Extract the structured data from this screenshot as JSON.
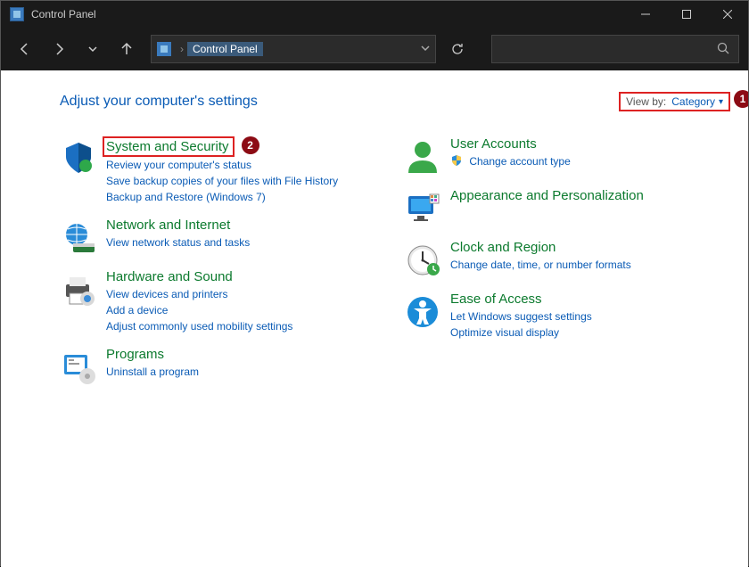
{
  "window": {
    "title": "Control Panel"
  },
  "address": {
    "location": "Control Panel"
  },
  "page": {
    "heading": "Adjust your computer's settings",
    "viewby_label": "View by:",
    "viewby_value": "Category"
  },
  "annotations": {
    "badge1": "1",
    "badge2": "2"
  },
  "categories": {
    "left": [
      {
        "title": "System and Security",
        "links": [
          "Review your computer's status",
          "Save backup copies of your files with File History",
          "Backup and Restore (Windows 7)"
        ],
        "icon": "shield",
        "highlighted": true
      },
      {
        "title": "Network and Internet",
        "links": [
          "View network status and tasks"
        ],
        "icon": "globe"
      },
      {
        "title": "Hardware and Sound",
        "links": [
          "View devices and printers",
          "Add a device",
          "Adjust commonly used mobility settings"
        ],
        "icon": "printer"
      },
      {
        "title": "Programs",
        "links": [
          "Uninstall a program"
        ],
        "icon": "programs"
      }
    ],
    "right": [
      {
        "title": "User Accounts",
        "links": [
          "Change account type"
        ],
        "icon": "user",
        "shield_on_first": true
      },
      {
        "title": "Appearance and Personalization",
        "links": [],
        "icon": "monitor"
      },
      {
        "title": "Clock and Region",
        "links": [
          "Change date, time, or number formats"
        ],
        "icon": "clock"
      },
      {
        "title": "Ease of Access",
        "links": [
          "Let Windows suggest settings",
          "Optimize visual display"
        ],
        "icon": "ease"
      }
    ]
  }
}
